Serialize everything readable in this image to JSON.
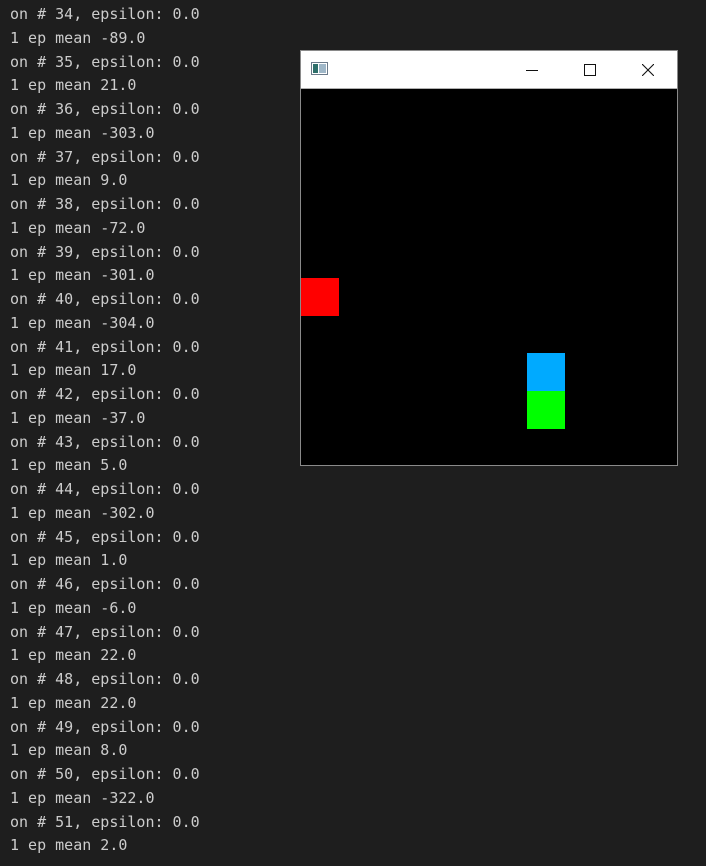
{
  "terminal": {
    "lines": [
      "on # 34, epsilon: 0.0",
      "1 ep mean -89.0",
      "on # 35, epsilon: 0.0",
      "1 ep mean 21.0",
      "on # 36, epsilon: 0.0",
      "1 ep mean -303.0",
      "on # 37, epsilon: 0.0",
      "1 ep mean 9.0",
      "on # 38, epsilon: 0.0",
      "1 ep mean -72.0",
      "on # 39, epsilon: 0.0",
      "1 ep mean -301.0",
      "on # 40, epsilon: 0.0",
      "1 ep mean -304.0",
      "on # 41, epsilon: 0.0",
      "1 ep mean 17.0",
      "on # 42, epsilon: 0.0",
      "1 ep mean -37.0",
      "on # 43, epsilon: 0.0",
      "1 ep mean 5.0",
      "on # 44, epsilon: 0.0",
      "1 ep mean -302.0",
      "on # 45, epsilon: 0.0",
      "1 ep mean 1.0",
      "on # 46, epsilon: 0.0",
      "1 ep mean -6.0",
      "on # 47, epsilon: 0.0",
      "1 ep mean 22.0",
      "on # 48, epsilon: 0.0",
      "1 ep mean 22.0",
      "on # 49, epsilon: 0.0",
      "1 ep mean 8.0",
      "on # 50, epsilon: 0.0",
      "1 ep mean -322.0",
      "on # 51, epsilon: 0.0",
      "1 ep mean 2.0"
    ]
  },
  "game_window": {
    "icon": "window-app-icon",
    "controls": [
      "minimize-icon",
      "maximize-icon",
      "close-icon"
    ],
    "colors": {
      "background": "#000000",
      "enemy": "#ff0000",
      "player": "#00aaff",
      "food": "#00ff00"
    }
  }
}
